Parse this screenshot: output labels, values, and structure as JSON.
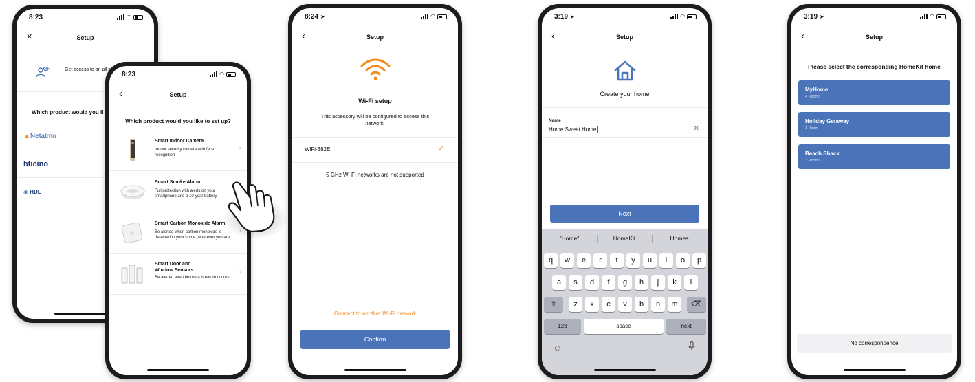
{
  "accent": "#4a73b9",
  "orange": "#f28a1d",
  "phone1": {
    "time": "8:23",
    "close_icon": "✕",
    "title": "Setup",
    "promo_text": "Get access to an all installed product",
    "question": "Which product would you li",
    "brands": {
      "netatmo": "Netatmo",
      "bticino": "bticino",
      "hdl": "HDL"
    }
  },
  "phone2": {
    "time": "8:23",
    "title": "Setup",
    "question": "Which product would you like to set up?",
    "products": [
      {
        "name": "Smart Indoor Camera",
        "desc": "Indoor security camera with face recognition"
      },
      {
        "name": "Smart Smoke Alarm",
        "desc": "Full protection with alerts on your smartphone and a 10-year battery"
      },
      {
        "name": "Smart Carbon Monoxide Alarm",
        "desc": "Be alerted when carbon monoxide is detected in your home, wherever you are"
      },
      {
        "name": "Smart Door and Window Sensors",
        "desc": "Be alerted even before a break-in occurs"
      }
    ]
  },
  "phone3": {
    "time": "8:24",
    "title": "Setup",
    "heading": "Wi-Fi setup",
    "subtitle": "This accessory will be configured to access this network:",
    "network": "WiFi-382E",
    "note": "5 GHz Wi-Fi networks are not supported",
    "other_link": "Connect to another Wi-Fi network",
    "confirm": "Confirm"
  },
  "phone4": {
    "time": "3:19",
    "title": "Setup",
    "heading": "Create your home",
    "name_label": "Name",
    "name_value": "Home Sweet Home",
    "next": "Next",
    "suggestions": [
      "\"Home\"",
      "HomeKit",
      "Homes"
    ],
    "row1": [
      "q",
      "w",
      "e",
      "r",
      "t",
      "y",
      "u",
      "i",
      "o",
      "p"
    ],
    "row2": [
      "a",
      "s",
      "d",
      "f",
      "g",
      "h",
      "j",
      "k",
      "l"
    ],
    "row3": [
      "z",
      "x",
      "c",
      "v",
      "b",
      "n",
      "m"
    ],
    "key_123": "123",
    "key_space": "space",
    "key_next": "next"
  },
  "phone5": {
    "time": "3:19",
    "title": "Setup",
    "heading": "Please select the corresponding HomeKit home",
    "homes": [
      {
        "name": "MyHome",
        "rooms": "4 Rooms"
      },
      {
        "name": "Holiday Getaway",
        "rooms": "1 Room"
      },
      {
        "name": "Beach Shack",
        "rooms": "3 Rooms"
      }
    ],
    "no_correspondence": "No correspondence"
  }
}
